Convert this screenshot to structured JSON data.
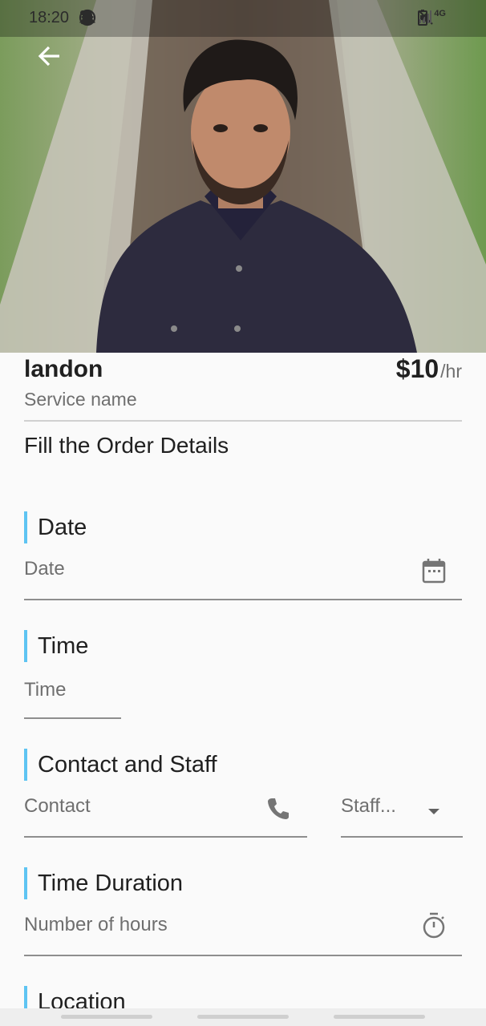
{
  "status_bar": {
    "time": "18:20",
    "left_icons": [
      "whatsapp-icon",
      "snapchat-icon",
      "snapchat-icon",
      "dot-icon"
    ],
    "right_icons": [
      "mute-icon",
      "signal-icon",
      "4g-icon",
      "signal-icon",
      "battery-icon"
    ],
    "network_label": "4G"
  },
  "profile": {
    "name": "landon",
    "service": "Service name",
    "price": "$10",
    "price_unit": "/hr"
  },
  "form": {
    "title": "Fill the Order Details",
    "sections": {
      "date": {
        "heading": "Date",
        "placeholder": "Date"
      },
      "time": {
        "heading": "Time",
        "placeholder": "Time"
      },
      "contact": {
        "heading": "Contact and Staff",
        "contact_placeholder": "Contact",
        "staff_placeholder": "Staff..."
      },
      "duration": {
        "heading": "Time Duration",
        "placeholder": "Number of hours"
      },
      "location": {
        "heading": "Location"
      }
    }
  },
  "colors": {
    "accent_bar": "#5ec4f2",
    "background": "#fafafa",
    "underline": "#8e8e8e"
  }
}
